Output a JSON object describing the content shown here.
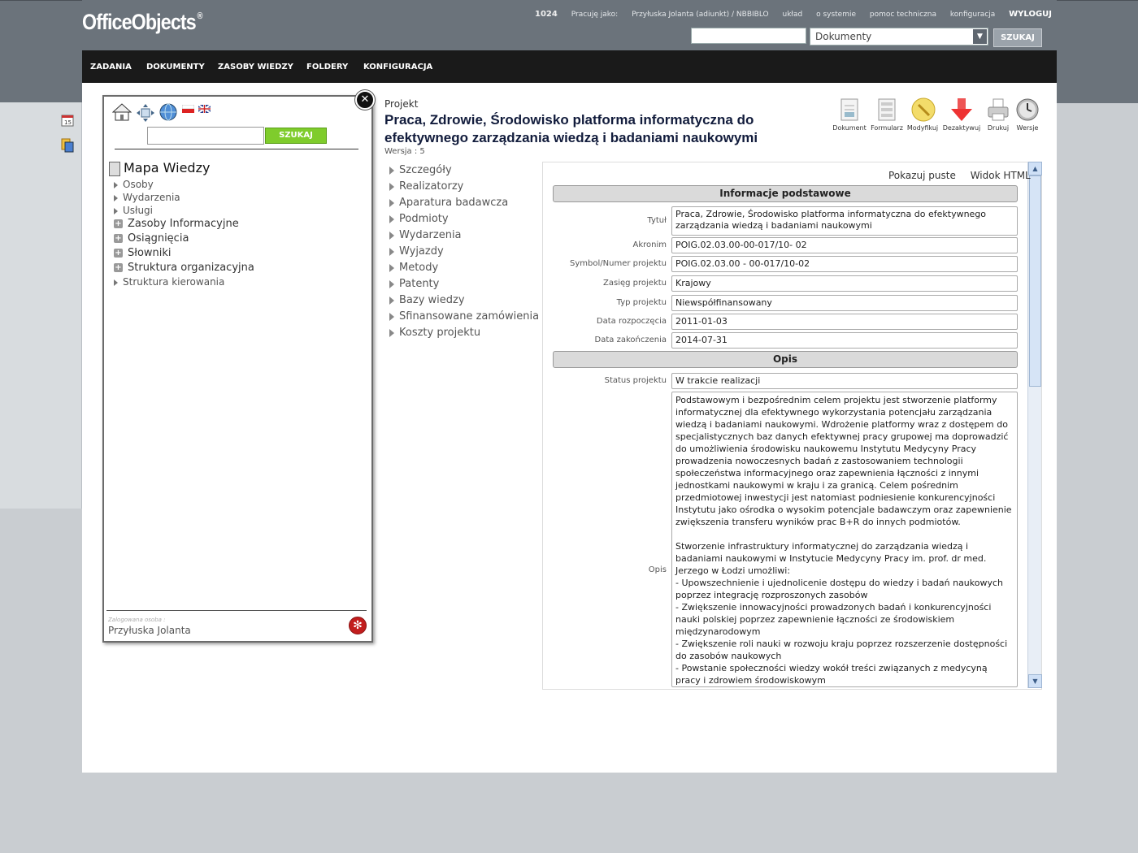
{
  "app": {
    "logo": "OfficeObjects",
    "logo_mark": "®"
  },
  "topnav": {
    "session_id": "1024",
    "working_as_label": "Pracuję jako:",
    "user_role": "Przyłuska Jolanta (adiunkt) / NBBIBLO",
    "layout": "układ",
    "about": "o systemie",
    "help": "pomoc techniczna",
    "config": "konfiguracja",
    "logout": "WYLOGUJ"
  },
  "search": {
    "query": "",
    "scope": "Dokumenty",
    "button": "SZUKAJ"
  },
  "mainmenu": [
    "ZADANIA",
    "DOKUMENTY",
    "ZASOBY WIEDZY",
    "FOLDERY",
    "KONFIGURACJA"
  ],
  "kmap": {
    "search_button": "SZUKAJ",
    "search_query": "",
    "title": "Mapa Wiedzy",
    "items": [
      {
        "label": "Osoby",
        "kind": "leaf"
      },
      {
        "label": "Wydarzenia",
        "kind": "leaf"
      },
      {
        "label": "Usługi",
        "kind": "leaf"
      },
      {
        "label": "Zasoby Informacyjne",
        "kind": "folder"
      },
      {
        "label": "Osiągnięcia",
        "kind": "folder"
      },
      {
        "label": "Słowniki",
        "kind": "folder"
      },
      {
        "label": "Struktura organizacyjna",
        "kind": "folder"
      },
      {
        "label": "Struktura kierowania",
        "kind": "leaf"
      }
    ],
    "logged_caption": "Zalogowana osoba :",
    "logged_user": "Przyłuska Jolanta"
  },
  "project": {
    "type_label": "Projekt",
    "title": "Praca, Zdrowie, Środowisko platforma informatyczna do efektywnego zarządzania wiedzą i badaniami naukowymi",
    "version": "Wersja : 5"
  },
  "toolbar": [
    "Dokument",
    "Formularz",
    "Modyfikuj",
    "Dezaktywuj",
    "Drukuj",
    "Wersje"
  ],
  "sections": [
    "Szczegóły",
    "Realizatorzy",
    "Aparatura badawcza",
    "Podmioty",
    "Wydarzenia",
    "Wyjazdy",
    "Metody",
    "Patenty",
    "Bazy wiedzy",
    "Sfinansowane zamówienia",
    "Koszty projektu"
  ],
  "detail": {
    "show_empty": "Pokazuj puste",
    "html_view": "Widok HTML",
    "section_basic": "Informacje podstawowe",
    "section_desc": "Opis",
    "fields": {
      "tytul_label": "Tytuł",
      "tytul": "Praca, Zdrowie, Środowisko platforma informatyczna do efektywnego zarządzania wiedzą i badaniami naukowymi",
      "akronim_label": "Akronim",
      "akronim": "POIG.02.03.00-00-017/10- 02",
      "symbol_label": "Symbol/Numer projektu",
      "symbol": "POIG.02.03.00 - 00-017/10-02",
      "zasieg_label": "Zasięg projektu",
      "zasieg": "Krajowy",
      "typ_label": "Typ projektu",
      "typ": "Niewspółfinansowany",
      "start_label": "Data rozpoczęcia",
      "start": "2011-01-03",
      "end_label": "Data zakończenia",
      "end": "2014-07-31",
      "status_label": "Status projektu",
      "status": "W trakcie realizacji",
      "opis_label": "Opis",
      "opis": "Podstawowym i bezpośrednim celem projektu jest stworzenie platformy informatycznej dla efektywnego wykorzystania potencjału zarządzania wiedzą i badaniami naukowymi. Wdrożenie platformy wraz z dostępem do specjalistycznych baz danych efektywnej pracy grupowej ma doprowadzić do umożliwienia środowisku naukowemu Instytutu Medycyny Pracy prowadzenia nowoczesnych badań z zastosowaniem technologii społeczeństwa informacyjnego oraz zapewnienia łączności z innymi jednostkami naukowymi w kraju i za granicą. Celem pośrednim przedmiotowej inwestycji jest natomiast podniesienie konkurencyjności Instytutu jako ośrodka o wysokim potencjale badawczym oraz zapewnienie zwiększenia transferu wyników prac B+R do innych podmiotów.\n\nStworzenie infrastruktury informatycznej do zarządzania wiedzą i badaniami naukowymi w Instytucie Medycyny Pracy im. prof. dr med. Jerzego w Łodzi umożliwi:\n- Upowszechnienie i ujednolicenie dostępu do wiedzy i badań naukowych poprzez integrację rozproszonych zasobów\n- Zwiększenie innowacyjności prowadzonych badań i konkurencyjności nauki polskiej poprzez zapewnienie łączności ze środowiskiem międzynarodowym\n- Zwiększenie roli nauki w rozwoju kraju poprzez rozszerzenie dostępności do zasobów naukowych\n- Powstanie społeczności wiedzy wokół treści związanych z medycyną pracy i zdrowiem środowiskowym"
    }
  }
}
